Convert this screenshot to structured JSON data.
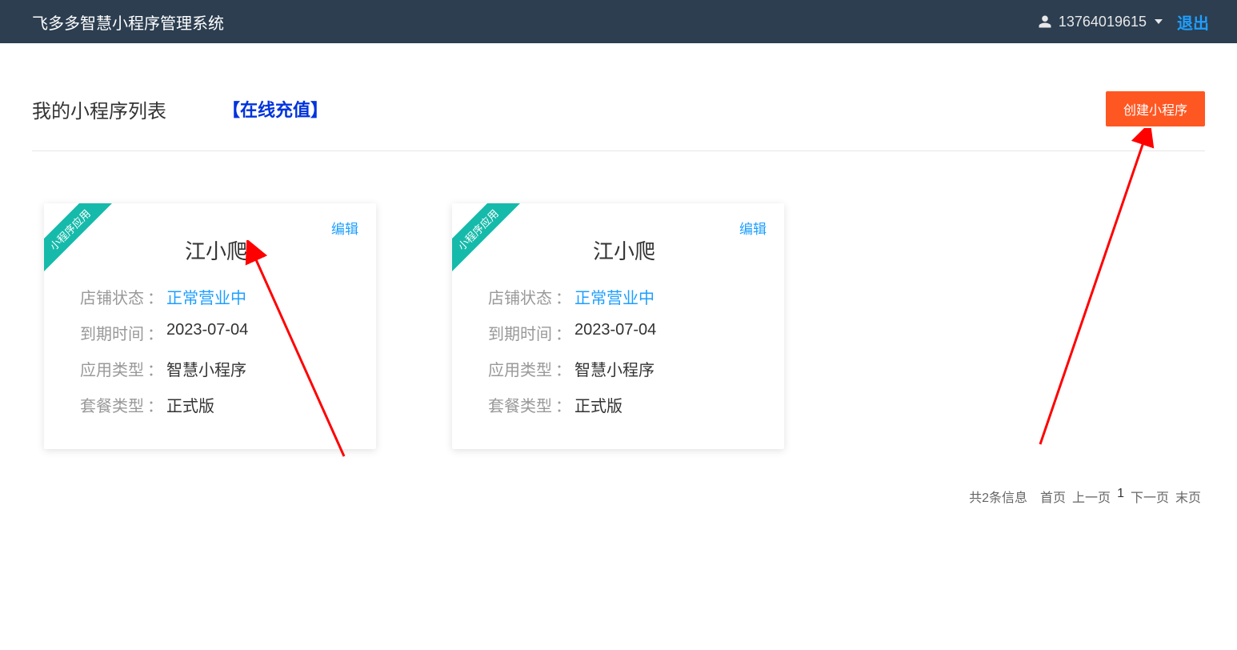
{
  "header": {
    "title": "飞多多智慧小程序管理系统",
    "user_phone": "13764019615",
    "logout": "退出"
  },
  "page": {
    "title": "我的小程序列表",
    "recharge": "【在线充值】",
    "create_button": "创建小程序"
  },
  "labels": {
    "shop_status": "店铺状态",
    "expire_time": "到期时间",
    "app_type": "应用类型",
    "plan_type": "套餐类型",
    "sep": "："
  },
  "common": {
    "ribbon": "小程序应用",
    "edit": "编辑"
  },
  "cards": [
    {
      "name": "江小爬",
      "status": "正常营业中",
      "expire": "2023-07-04",
      "app_type": "智慧小程序",
      "plan": "正式版"
    },
    {
      "name": "江小爬",
      "status": "正常营业中",
      "expire": "2023-07-04",
      "app_type": "智慧小程序",
      "plan": "正式版"
    }
  ],
  "pagination": {
    "total": "共2条信息",
    "first": "首页",
    "prev": "上一页",
    "current": "1",
    "next": "下一页",
    "last": "末页"
  }
}
